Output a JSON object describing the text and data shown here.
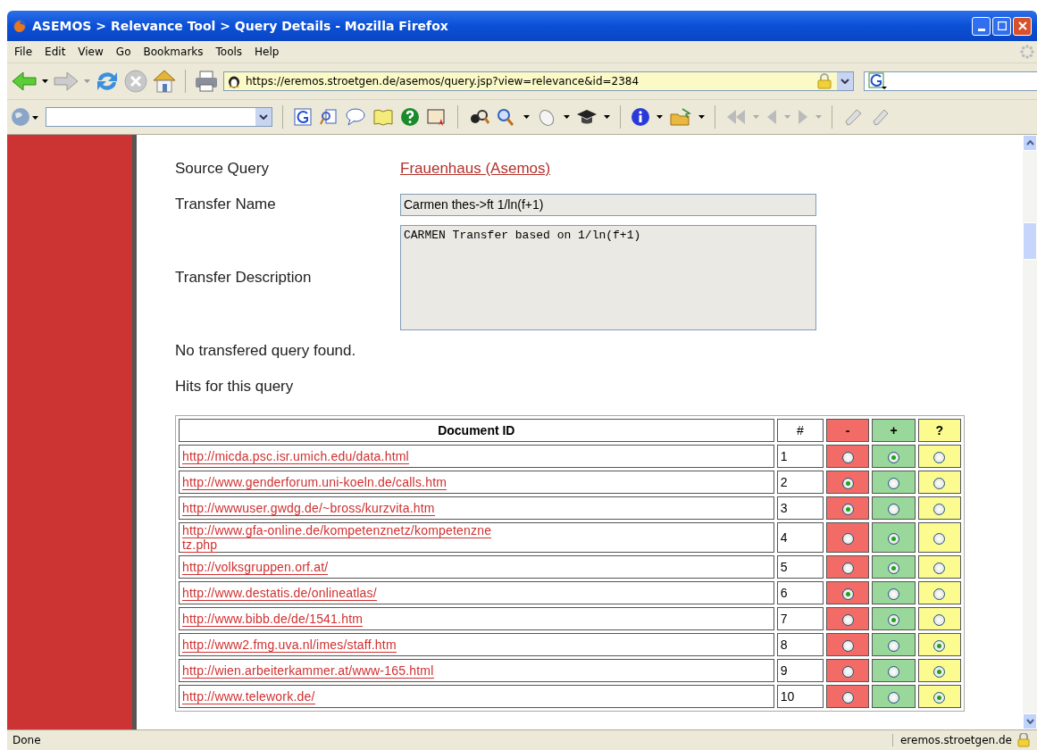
{
  "window": {
    "title": "ASEMOS > Relevance Tool > Query Details - Mozilla Firefox"
  },
  "menu": [
    "File",
    "Edit",
    "View",
    "Go",
    "Bookmarks",
    "Tools",
    "Help"
  ],
  "address": {
    "value": "https://eremos.stroetgen.de/asemos/query.jsp?view=relevance&id=2384"
  },
  "details": [
    {
      "label": "Source Query",
      "kind": "link",
      "value": "Frauenhaus (Asemos)"
    },
    {
      "label": "Transfer Name",
      "kind": "field",
      "value": "Carmen thes->ft 1/ln(f+1)"
    },
    {
      "label": "Transfer Description",
      "kind": "textarea",
      "value": "CARMEN Transfer based on 1/ln(f+1)"
    }
  ],
  "notes": [
    "No transfered query found.",
    "Hits for this query"
  ],
  "table": {
    "columns": [
      {
        "label": "Document ID"
      },
      {
        "label": "#"
      },
      {
        "label": "-",
        "color": "#f26b66"
      },
      {
        "label": "+",
        "color": "#9ad79a"
      },
      {
        "label": "?",
        "color": "#fbfb8f"
      }
    ],
    "rows": [
      {
        "url": "http://micda.psc.isr.umich.edu/data.html",
        "n": "1",
        "options": [
          {
            "selected": false
          },
          {
            "selected": true
          },
          {
            "selected": false
          }
        ]
      },
      {
        "url": "http://www.genderforum.uni-koeln.de/calls.htm",
        "n": "2",
        "options": [
          {
            "selected": true
          },
          {
            "selected": false
          },
          {
            "selected": false
          }
        ]
      },
      {
        "url": "http://wwwuser.gwdg.de/~bross/kurzvita.htm",
        "n": "3",
        "options": [
          {
            "selected": true
          },
          {
            "selected": false
          },
          {
            "selected": false
          }
        ]
      },
      {
        "url": "http://www.gfa-online.de/kompetenznetz/kompetenzne",
        "url2": "tz.php",
        "n": "4",
        "options": [
          {
            "selected": false
          },
          {
            "selected": true
          },
          {
            "selected": false
          }
        ]
      },
      {
        "url": "http://volksgruppen.orf.at/",
        "n": "5",
        "options": [
          {
            "selected": false
          },
          {
            "selected": true
          },
          {
            "selected": false
          }
        ]
      },
      {
        "url": "http://www.destatis.de/onlineatlas/",
        "n": "6",
        "options": [
          {
            "selected": true
          },
          {
            "selected": false
          },
          {
            "selected": false
          }
        ]
      },
      {
        "url": "http://www.bibb.de/de/1541.htm",
        "n": "7",
        "options": [
          {
            "selected": false
          },
          {
            "selected": true
          },
          {
            "selected": false
          }
        ]
      },
      {
        "url": "http://www2.fmg.uva.nl/imes/staff.htm",
        "n": "8",
        "options": [
          {
            "selected": false
          },
          {
            "selected": false
          },
          {
            "selected": true
          }
        ]
      },
      {
        "url": "http://wien.arbeiterkammer.at/www-165.html",
        "n": "9",
        "options": [
          {
            "selected": false
          },
          {
            "selected": false
          },
          {
            "selected": true
          }
        ]
      },
      {
        "url": "http://www.telework.de/",
        "n": "10",
        "options": [
          {
            "selected": false
          },
          {
            "selected": false
          },
          {
            "selected": true
          }
        ]
      }
    ]
  },
  "status_bar": {
    "left": "Done",
    "right": "eremos.stroetgen.de"
  }
}
